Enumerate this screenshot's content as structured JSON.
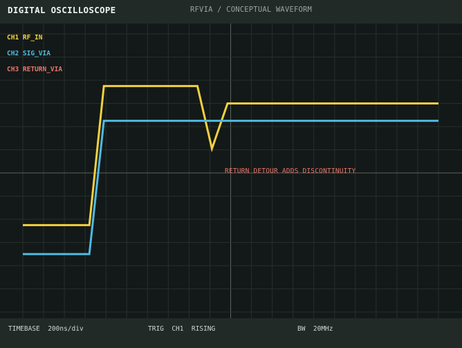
{
  "header": {
    "title": "DIGITAL OSCILLOSCOPE",
    "subtitle": "RFVIA / CONCEPTUAL WAVEFORM"
  },
  "channels": [
    {
      "label": "CH1 RF_IN",
      "color": "#f4d03f"
    },
    {
      "label": "CH2 SIG_VIA",
      "color": "#4fb9e1"
    },
    {
      "label": "CH3 RETURN_VIA",
      "color": "#e8756a"
    }
  ],
  "annotation": {
    "text": "RETURN DETOUR ADDS DISCONTINUITY",
    "color": "#e8756a"
  },
  "status": {
    "timebase": "TIMEBASE  200ns/div",
    "trigger": "TRIG  CH1  RISING",
    "bandwidth": "BW  20MHz"
  },
  "chart_data": {
    "type": "line",
    "grid": true,
    "axis_units": "divisions (horizontal 0–20, vertical 0 = centre line, up is positive)",
    "xlim": [
      0,
      20
    ],
    "ylim": [
      -6.35,
      6.35
    ],
    "series": [
      {
        "name": "CH1 RF_IN",
        "color": "#f4d03f",
        "points": [
          [
            0,
            -2.25
          ],
          [
            3.2,
            -2.25
          ],
          [
            3.9,
            3.75
          ],
          [
            8.4,
            3.75
          ],
          [
            9.1,
            1.05
          ],
          [
            9.85,
            3.0
          ],
          [
            20,
            3.0
          ]
        ]
      },
      {
        "name": "CH2 SIG_VIA",
        "color": "#4fb9e1",
        "points": [
          [
            0,
            -3.5
          ],
          [
            3.2,
            -3.5
          ],
          [
            3.9,
            2.25
          ],
          [
            20,
            2.25
          ]
        ]
      }
    ]
  }
}
